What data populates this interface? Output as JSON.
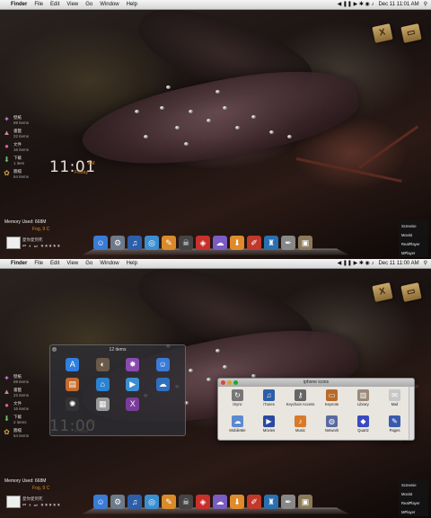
{
  "screens": [
    {
      "menubar": {
        "apple": "",
        "app": "Finder",
        "items": [
          "File",
          "Edit",
          "View",
          "Go",
          "Window",
          "Help"
        ],
        "clock": "Dec 11  11:01 AM"
      },
      "clock": {
        "hm": "11:01",
        "ampm": "AM",
        "day": "Friday"
      }
    },
    {
      "menubar": {
        "apple": "",
        "app": "Finder",
        "items": [
          "File",
          "Edit",
          "View",
          "Go",
          "Window",
          "Help"
        ],
        "clock": "Dec 11  11:00 AM"
      },
      "clock": {
        "hm": "11:00",
        "ampm": "AM",
        "day": "Friday"
      }
    }
  ],
  "sidebar": [
    {
      "icon": "star-icon",
      "glyph": "✦",
      "color": "#c77ad6",
      "label": "壁紙",
      "sub": "69 items"
    },
    {
      "icon": "bookmark-icon",
      "glyph": "▲",
      "color": "#c98a8a",
      "label": "書籤",
      "sub": "22 items"
    },
    {
      "icon": "document-icon",
      "glyph": "●",
      "color": "#e25c9a",
      "label": "文件",
      "sub": "16 items"
    },
    {
      "icon": "download-icon",
      "glyph": "⬇",
      "color": "#6cc26c",
      "label": "下載",
      "sub": "1 item"
    },
    {
      "icon": "picture-icon",
      "glyph": "✿",
      "color": "#d5a44a",
      "label": "圖檔",
      "sub": "64 items"
    }
  ],
  "sidebar_bottom": [
    {
      "icon": "star-icon",
      "glyph": "✦",
      "color": "#c77ad6",
      "label": "壁紙",
      "sub": "69 items"
    },
    {
      "icon": "bookmark-icon",
      "glyph": "▲",
      "color": "#c98a8a",
      "label": "書籤",
      "sub": "22 items"
    },
    {
      "icon": "document-icon",
      "glyph": "●",
      "color": "#e25c9a",
      "label": "文件",
      "sub": "16 items"
    },
    {
      "icon": "download-icon",
      "glyph": "⬇",
      "color": "#6cc26c",
      "label": "下載",
      "sub": "2 items"
    },
    {
      "icon": "picture-icon",
      "glyph": "✿",
      "color": "#d5a44a",
      "label": "圖檔",
      "sub": "64 items"
    }
  ],
  "memory": "Memory Used: 668M",
  "weather": "Fog, 9 C",
  "player": {
    "title": "愛你愛到死",
    "controls": "⏮ ⏸ ⏭  ★★★★★"
  },
  "dock_icons": [
    {
      "icon": "finder-icon",
      "glyph": "☺",
      "color": "#3a7bd5"
    },
    {
      "icon": "system-prefs-icon",
      "glyph": "⚙",
      "color": "#6c7a89"
    },
    {
      "icon": "itunes-icon",
      "glyph": "♫",
      "color": "#2d5ea8"
    },
    {
      "icon": "safari-icon",
      "glyph": "◎",
      "color": "#3b8fd1"
    },
    {
      "icon": "notes-icon",
      "glyph": "✎",
      "color": "#d98b2b"
    },
    {
      "icon": "skull-icon",
      "glyph": "☠",
      "color": "#444"
    },
    {
      "icon": "ichat-icon",
      "glyph": "◈",
      "color": "#c9302c"
    },
    {
      "icon": "cloud-icon",
      "glyph": "☁",
      "color": "#7a5cc2"
    },
    {
      "icon": "download-icon",
      "glyph": "⬇",
      "color": "#e08a2b"
    },
    {
      "icon": "brush-icon",
      "glyph": "✐",
      "color": "#c0392b"
    },
    {
      "icon": "space-icon",
      "glyph": "♜",
      "color": "#2a6fb0"
    },
    {
      "icon": "pen-icon",
      "glyph": "✒",
      "color": "#888"
    },
    {
      "icon": "trash-icon",
      "glyph": "▣",
      "color": "#8a7a5a"
    }
  ],
  "right_panel": [
    "Screenie",
    "Movist",
    "RealPlayer",
    "MPlayer"
  ],
  "launcher": {
    "title": "12 items",
    "icons": [
      {
        "icon": "app-store-icon",
        "glyph": "A",
        "color": "#2f7fe0"
      },
      {
        "icon": "photo-icon",
        "glyph": "◐",
        "color": "#6a5a4a"
      },
      {
        "icon": "pinwheel-icon",
        "glyph": "✸",
        "color": "#8a4ab0"
      },
      {
        "icon": "finder-icon",
        "glyph": "☺",
        "color": "#3a7bd5"
      },
      {
        "icon": "box-icon",
        "glyph": "▤",
        "color": "#c46a2a"
      },
      {
        "icon": "home-icon",
        "glyph": "⌂",
        "color": "#2a82d0"
      },
      {
        "icon": "facetime-icon",
        "glyph": "▶",
        "color": "#3b8fd1"
      },
      {
        "icon": "cloud-icon",
        "glyph": "☁",
        "color": "#2f6fc0"
      },
      {
        "icon": "lamp-icon",
        "glyph": "✺",
        "color": "#333"
      },
      {
        "icon": "grid-icon",
        "glyph": "▦",
        "color": "#999"
      },
      {
        "icon": "x11-icon",
        "glyph": "X",
        "color": "#7a3c9a"
      }
    ]
  },
  "finder_window": {
    "title": "iphone icons",
    "items": [
      {
        "icon": "iSync-icon",
        "glyph": "↻",
        "color": "#777",
        "label": "iSync"
      },
      {
        "icon": "itunes-icon",
        "glyph": "♫",
        "color": "#2d5ea8",
        "label": "iTunes"
      },
      {
        "icon": "keychain-icon",
        "glyph": "⚷",
        "color": "#666",
        "label": "Keychain Access"
      },
      {
        "icon": "keynote-icon",
        "glyph": "▭",
        "color": "#b86a2a",
        "label": "Keynote"
      },
      {
        "icon": "library-icon",
        "glyph": "▥",
        "color": "#9a8a7a",
        "label": "Library"
      },
      {
        "icon": "mail-icon",
        "glyph": "✉",
        "color": "#c7c7c7",
        "label": "Mail"
      },
      {
        "icon": "mobileme-icon",
        "glyph": "☁",
        "color": "#5a8ad0",
        "label": "MobileMe"
      },
      {
        "icon": "movies-icon",
        "glyph": "▶",
        "color": "#2a4aa0",
        "label": "Movies"
      },
      {
        "icon": "music-icon",
        "glyph": "♪",
        "color": "#d97a2a",
        "label": "Music"
      },
      {
        "icon": "network-icon",
        "glyph": "◍",
        "color": "#5a6aa0",
        "label": "Network"
      },
      {
        "icon": "quartz-icon",
        "glyph": "◆",
        "color": "#3a4ac0",
        "label": "Quartz"
      },
      {
        "icon": "pages-icon",
        "glyph": "✎",
        "color": "#3a5ab0",
        "label": "Pages"
      }
    ]
  }
}
